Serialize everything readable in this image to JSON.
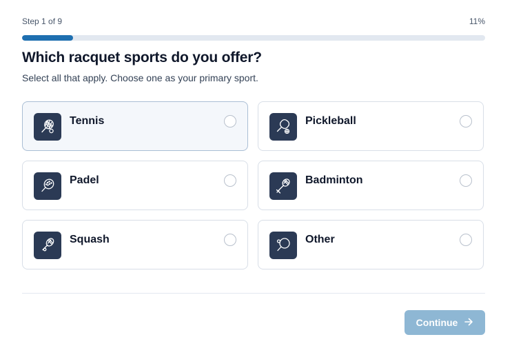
{
  "header": {
    "step_text": "Step 1 of 9",
    "progress_text": "11%",
    "progress_fraction": 0.11
  },
  "question": {
    "title": "Which racquet sports do you offer?",
    "subtitle": "Select all that apply. Choose one as your primary sport."
  },
  "options": [
    {
      "label": "Tennis",
      "icon": "tennis-racquet-icon",
      "selected": false,
      "highlighted": true
    },
    {
      "label": "Pickleball",
      "icon": "pickleball-paddle-icon",
      "selected": false,
      "highlighted": false
    },
    {
      "label": "Padel",
      "icon": "padel-racquet-icon",
      "selected": false,
      "highlighted": false
    },
    {
      "label": "Badminton",
      "icon": "badminton-racquet-icon",
      "selected": false,
      "highlighted": false
    },
    {
      "label": "Squash",
      "icon": "squash-racquet-icon",
      "selected": false,
      "highlighted": false
    },
    {
      "label": "Other",
      "icon": "table-tennis-paddle-icon",
      "selected": false,
      "highlighted": false
    }
  ],
  "footer": {
    "continue_label": "Continue",
    "continue_icon": "arrow-right-icon"
  },
  "colors": {
    "accent": "#1e6fb0",
    "icon_bg": "#2b3a55",
    "button_disabled": "#8eb7d4"
  }
}
